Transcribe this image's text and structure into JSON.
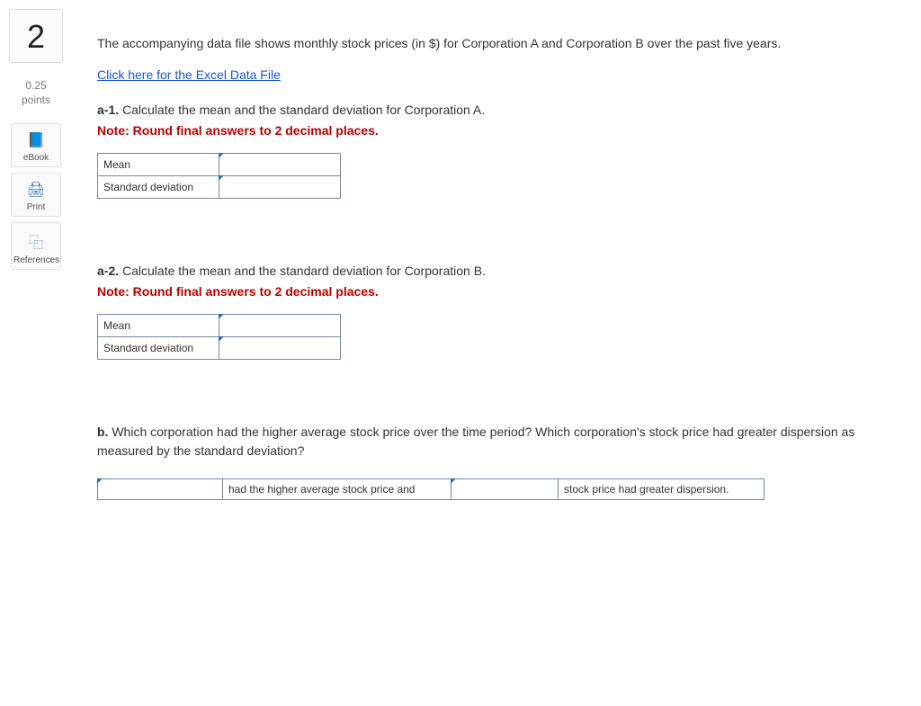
{
  "sidebar": {
    "question_number": "2",
    "points_value": "0.25",
    "points_label": "points",
    "buttons": [
      {
        "label": "eBook",
        "icon": "📘"
      },
      {
        "label": "Print",
        "icon": "🖨"
      },
      {
        "label": "References",
        "icon": "⿻"
      }
    ]
  },
  "content": {
    "intro": "The accompanying data file shows monthly stock prices (in $) for Corporation A and Corporation B over the past five years.",
    "excel_link": "Click here for the Excel Data File",
    "a1": {
      "label": "a-1.",
      "prompt": "Calculate the mean and the standard deviation for Corporation A.",
      "note": "Note: Round final answers to 2 decimal places.",
      "rows": [
        "Mean",
        "Standard deviation"
      ]
    },
    "a2": {
      "label": "a-2.",
      "prompt": "Calculate the mean and the standard deviation for Corporation B.",
      "note": "Note: Round final answers to 2 decimal places.",
      "rows": [
        "Mean",
        "Standard deviation"
      ]
    },
    "b": {
      "label": "b.",
      "prompt": "Which corporation had the higher average stock price over the time period? Which corporation's stock price had greater dispersion as measured by the standard deviation?",
      "seg1": "had the higher average stock price and",
      "seg2": "stock price had greater dispersion."
    }
  }
}
